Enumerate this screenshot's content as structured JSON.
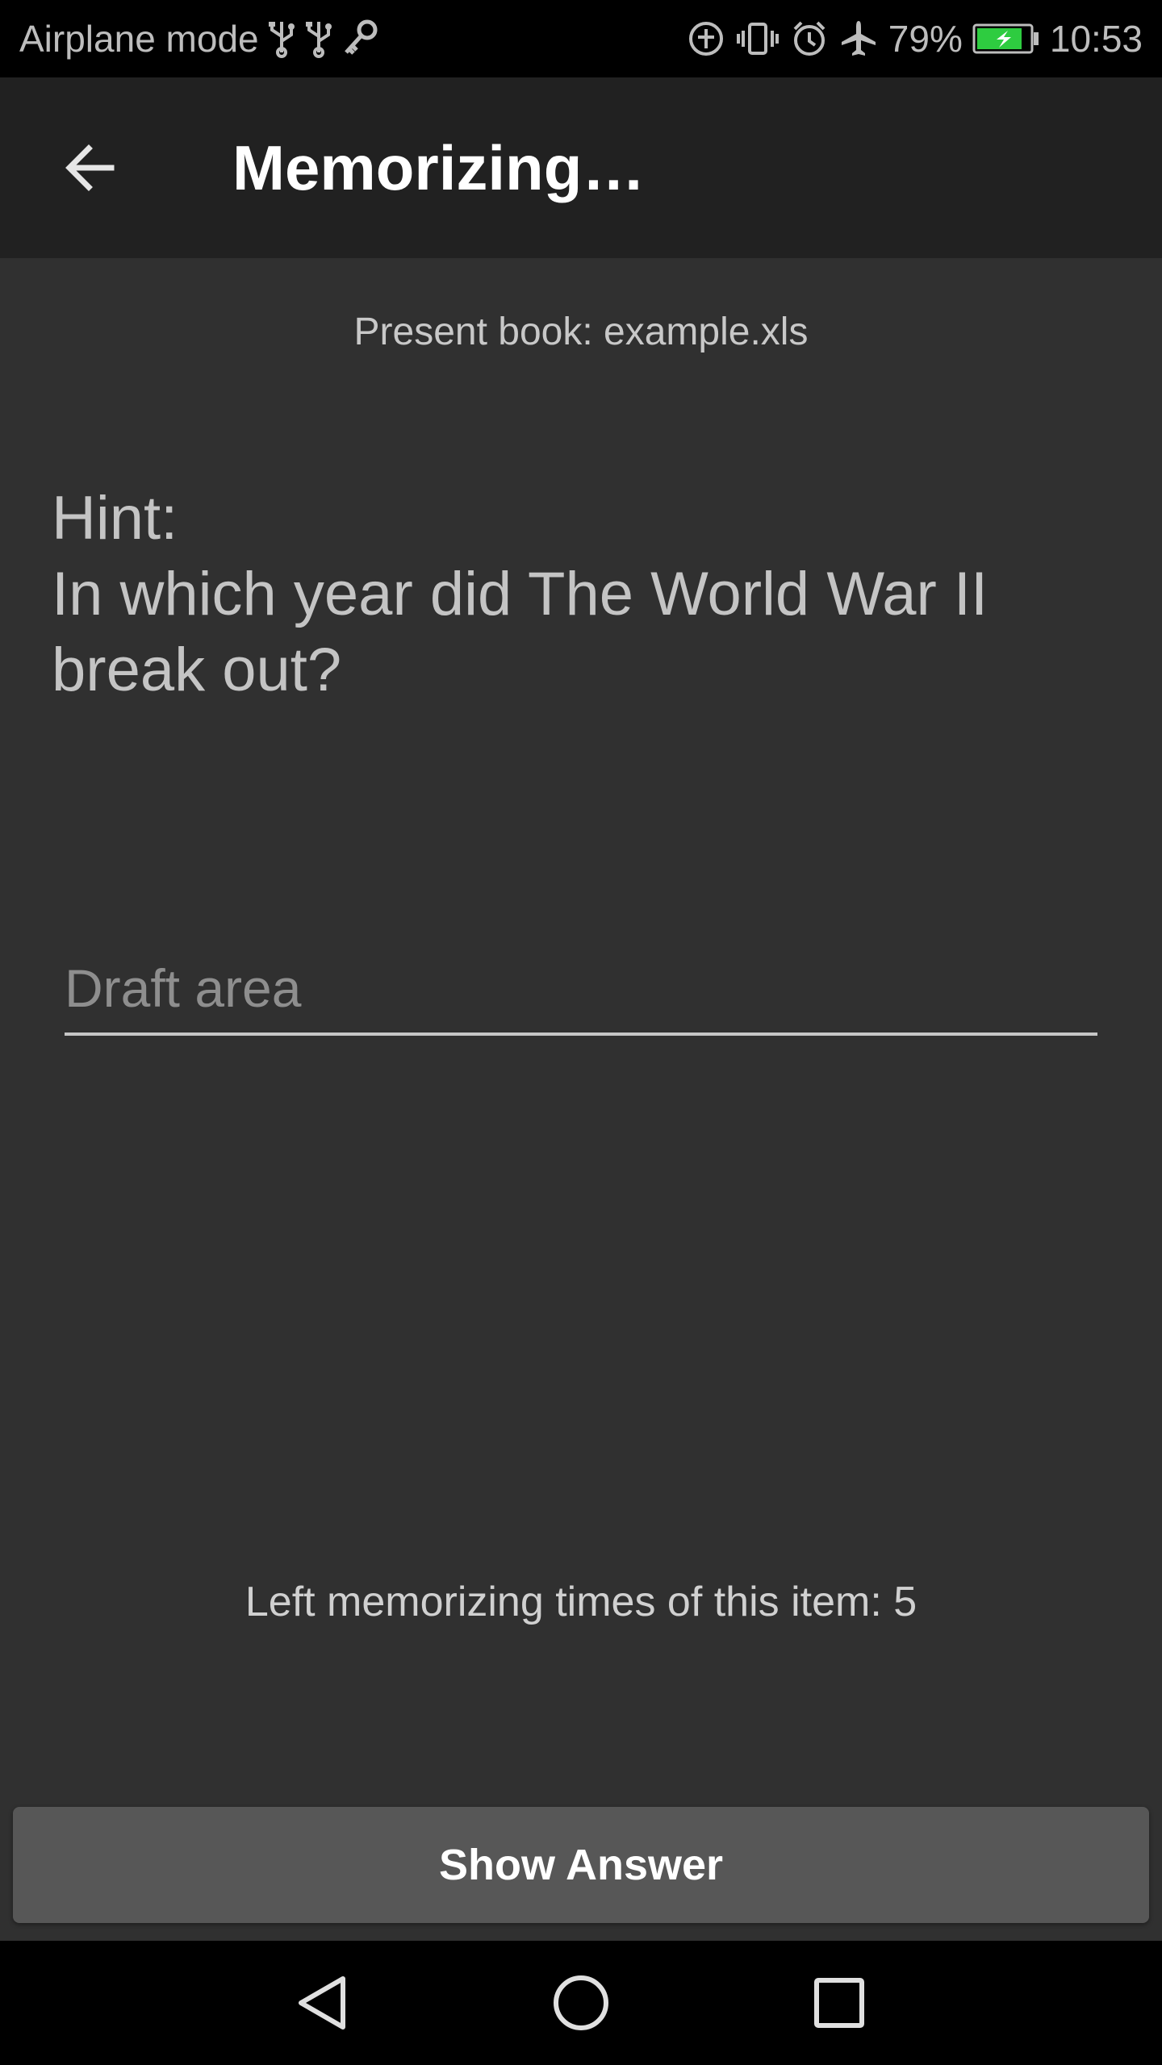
{
  "status_bar": {
    "left_text": "Airplane mode",
    "battery_percent": "79%",
    "time": "10:53",
    "battery_color": "#2ecc40",
    "icons_left": [
      "usb-icon",
      "usb-icon",
      "key-icon"
    ],
    "icons_right": [
      "data-saver-icon",
      "vibrate-icon",
      "alarm-icon",
      "airplane-icon",
      "battery-charging-icon"
    ]
  },
  "app_bar": {
    "title": "Memorizing…",
    "back_icon": "arrow-back-icon"
  },
  "main": {
    "book_line": "Present book: example.xls",
    "hint_label": "Hint:",
    "hint_text": "In which year did The World War II break out?",
    "draft_placeholder": "Draft area",
    "draft_value": "",
    "left_times": "Left memorizing times of this item: 5",
    "show_answer_label": "Show Answer"
  },
  "nav_bar": {
    "icons": [
      "back-triangle-icon",
      "home-circle-icon",
      "recents-square-icon"
    ]
  },
  "colors": {
    "background": "#303030",
    "app_bar": "#212121",
    "button": "#575757"
  }
}
